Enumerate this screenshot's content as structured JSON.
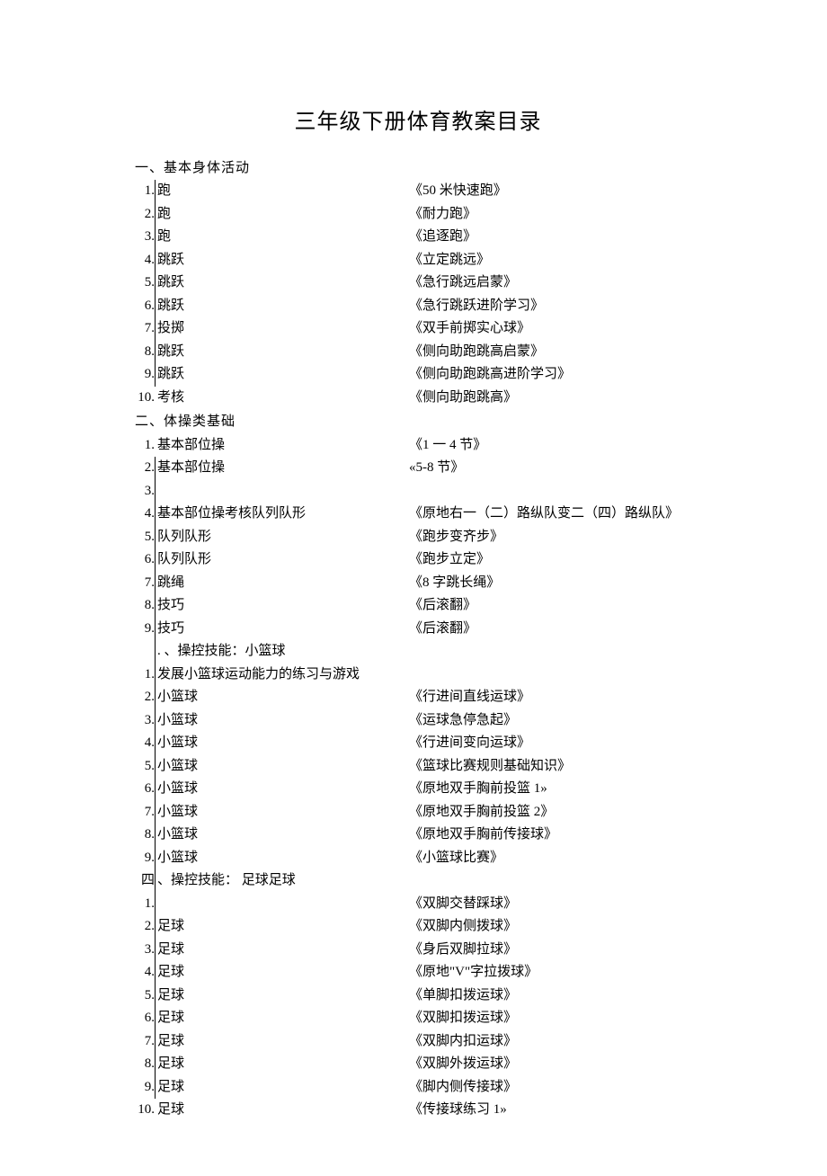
{
  "title": "三年级下册体育教案目录",
  "sections": [
    {
      "heading": "一、基本身体活动",
      "items": [
        {
          "num": "1.",
          "left": "跑",
          "right": "《50 米快速跑》"
        },
        {
          "num": "2.",
          "left": "跑",
          "right": "《耐力跑》"
        },
        {
          "num": "3.",
          "left": "跑",
          "right": "《追逐跑》"
        },
        {
          "num": "4.",
          "left": "跳跃",
          "right": "《立定跳远》"
        },
        {
          "num": "5.",
          "left": "跳跃",
          "right": "《急行跳远启蒙》"
        },
        {
          "num": "6.",
          "left": "跳跃",
          "right": "《急行跳跃进阶学习》"
        },
        {
          "num": "7.",
          "left": "投掷",
          "right": "《双手前掷实心球》"
        },
        {
          "num": "8.",
          "left": "跳跃",
          "right": "《侧向助跑跳高启蒙》"
        },
        {
          "num": "9.",
          "left": "跳跃",
          "right": "《侧向助跑跳高进阶学习》"
        },
        {
          "num": "10.",
          "left": "考核",
          "right": "《侧向助跑跳高》",
          "noborder": true
        }
      ]
    },
    {
      "heading": "二、体操类基础",
      "items": [
        {
          "num": "1.",
          "left": "基本部位操",
          "right": "《1 一 4 节》",
          "noborder": true
        },
        {
          "num": "2.",
          "left": "基本部位操",
          "right": "«5-8 节》"
        },
        {
          "num": "3.",
          "left": "",
          "right": ""
        },
        {
          "num": "4.",
          "left": "基本部位操考核队列队形",
          "right": "《原地右一（二）路纵队变二（四）路纵队》"
        },
        {
          "num": "5.",
          "left": "队列队形",
          "right": "《跑步变齐步》"
        },
        {
          "num": "6.",
          "left": "队列队形",
          "right": "《跑步立定》"
        },
        {
          "num": "7.",
          "left": "跳绳",
          "right": "《8 字跳长绳》"
        },
        {
          "num": "8.",
          "left": "技巧",
          "right": "《后滚翻》"
        },
        {
          "num": "9.",
          "left": "技巧",
          "right": "《后滚翻》"
        }
      ],
      "subheading": ". 、操控技能：小篮球"
    },
    {
      "heading": "",
      "items": [
        {
          "num": "1.",
          "left": "发展小篮球运动能力的练习与游戏",
          "right": ""
        },
        {
          "num": "2.",
          "left": "小篮球",
          "right": "《行进间直线运球》"
        },
        {
          "num": "3.",
          "left": "小篮球",
          "right": "《运球急停急起》"
        },
        {
          "num": "4.",
          "left": "小篮球",
          "right": "《行进间变向运球》"
        },
        {
          "num": "5.",
          "left": "小篮球",
          "right": "《篮球比赛规则基础知识》"
        },
        {
          "num": "6.",
          "left": "小篮球",
          "right": "《原地双手胸前投篮 1»"
        },
        {
          "num": "7.",
          "left": "小篮球",
          "right": "《原地双手胸前投篮 2》"
        },
        {
          "num": "8.",
          "left": "小篮球",
          "right": "《原地双手胸前传接球》"
        },
        {
          "num": "9.",
          "left": "小篮球",
          "right": "《小篮球比赛》"
        }
      ]
    },
    {
      "heading": "四、操控技能： 足球足球",
      "heading_border": true,
      "items": [
        {
          "num": "1.",
          "left": "",
          "right": "《双脚交替踩球》"
        },
        {
          "num": "2.",
          "left": "足球",
          "right": "《双脚内侧拨球》"
        },
        {
          "num": "3.",
          "left": "足球",
          "right": "《身后双脚拉球》"
        },
        {
          "num": "4.",
          "left": "足球",
          "right": "《原地\"V\"字拉拨球》"
        },
        {
          "num": "5.",
          "left": "足球",
          "right": "《单脚扣拨运球》"
        },
        {
          "num": "6.",
          "left": "足球",
          "right": "《双脚扣拨运球》"
        },
        {
          "num": "7.",
          "left": "足球",
          "right": "《双脚内扣运球》"
        },
        {
          "num": "8.",
          "left": "足球",
          "right": "《双脚外拨运球》"
        },
        {
          "num": "9.",
          "left": "足球",
          "right": "《脚内侧传接球》"
        },
        {
          "num": "10.",
          "left": "足球",
          "right": "《传接球练习 1»",
          "noborder": true
        }
      ]
    }
  ]
}
